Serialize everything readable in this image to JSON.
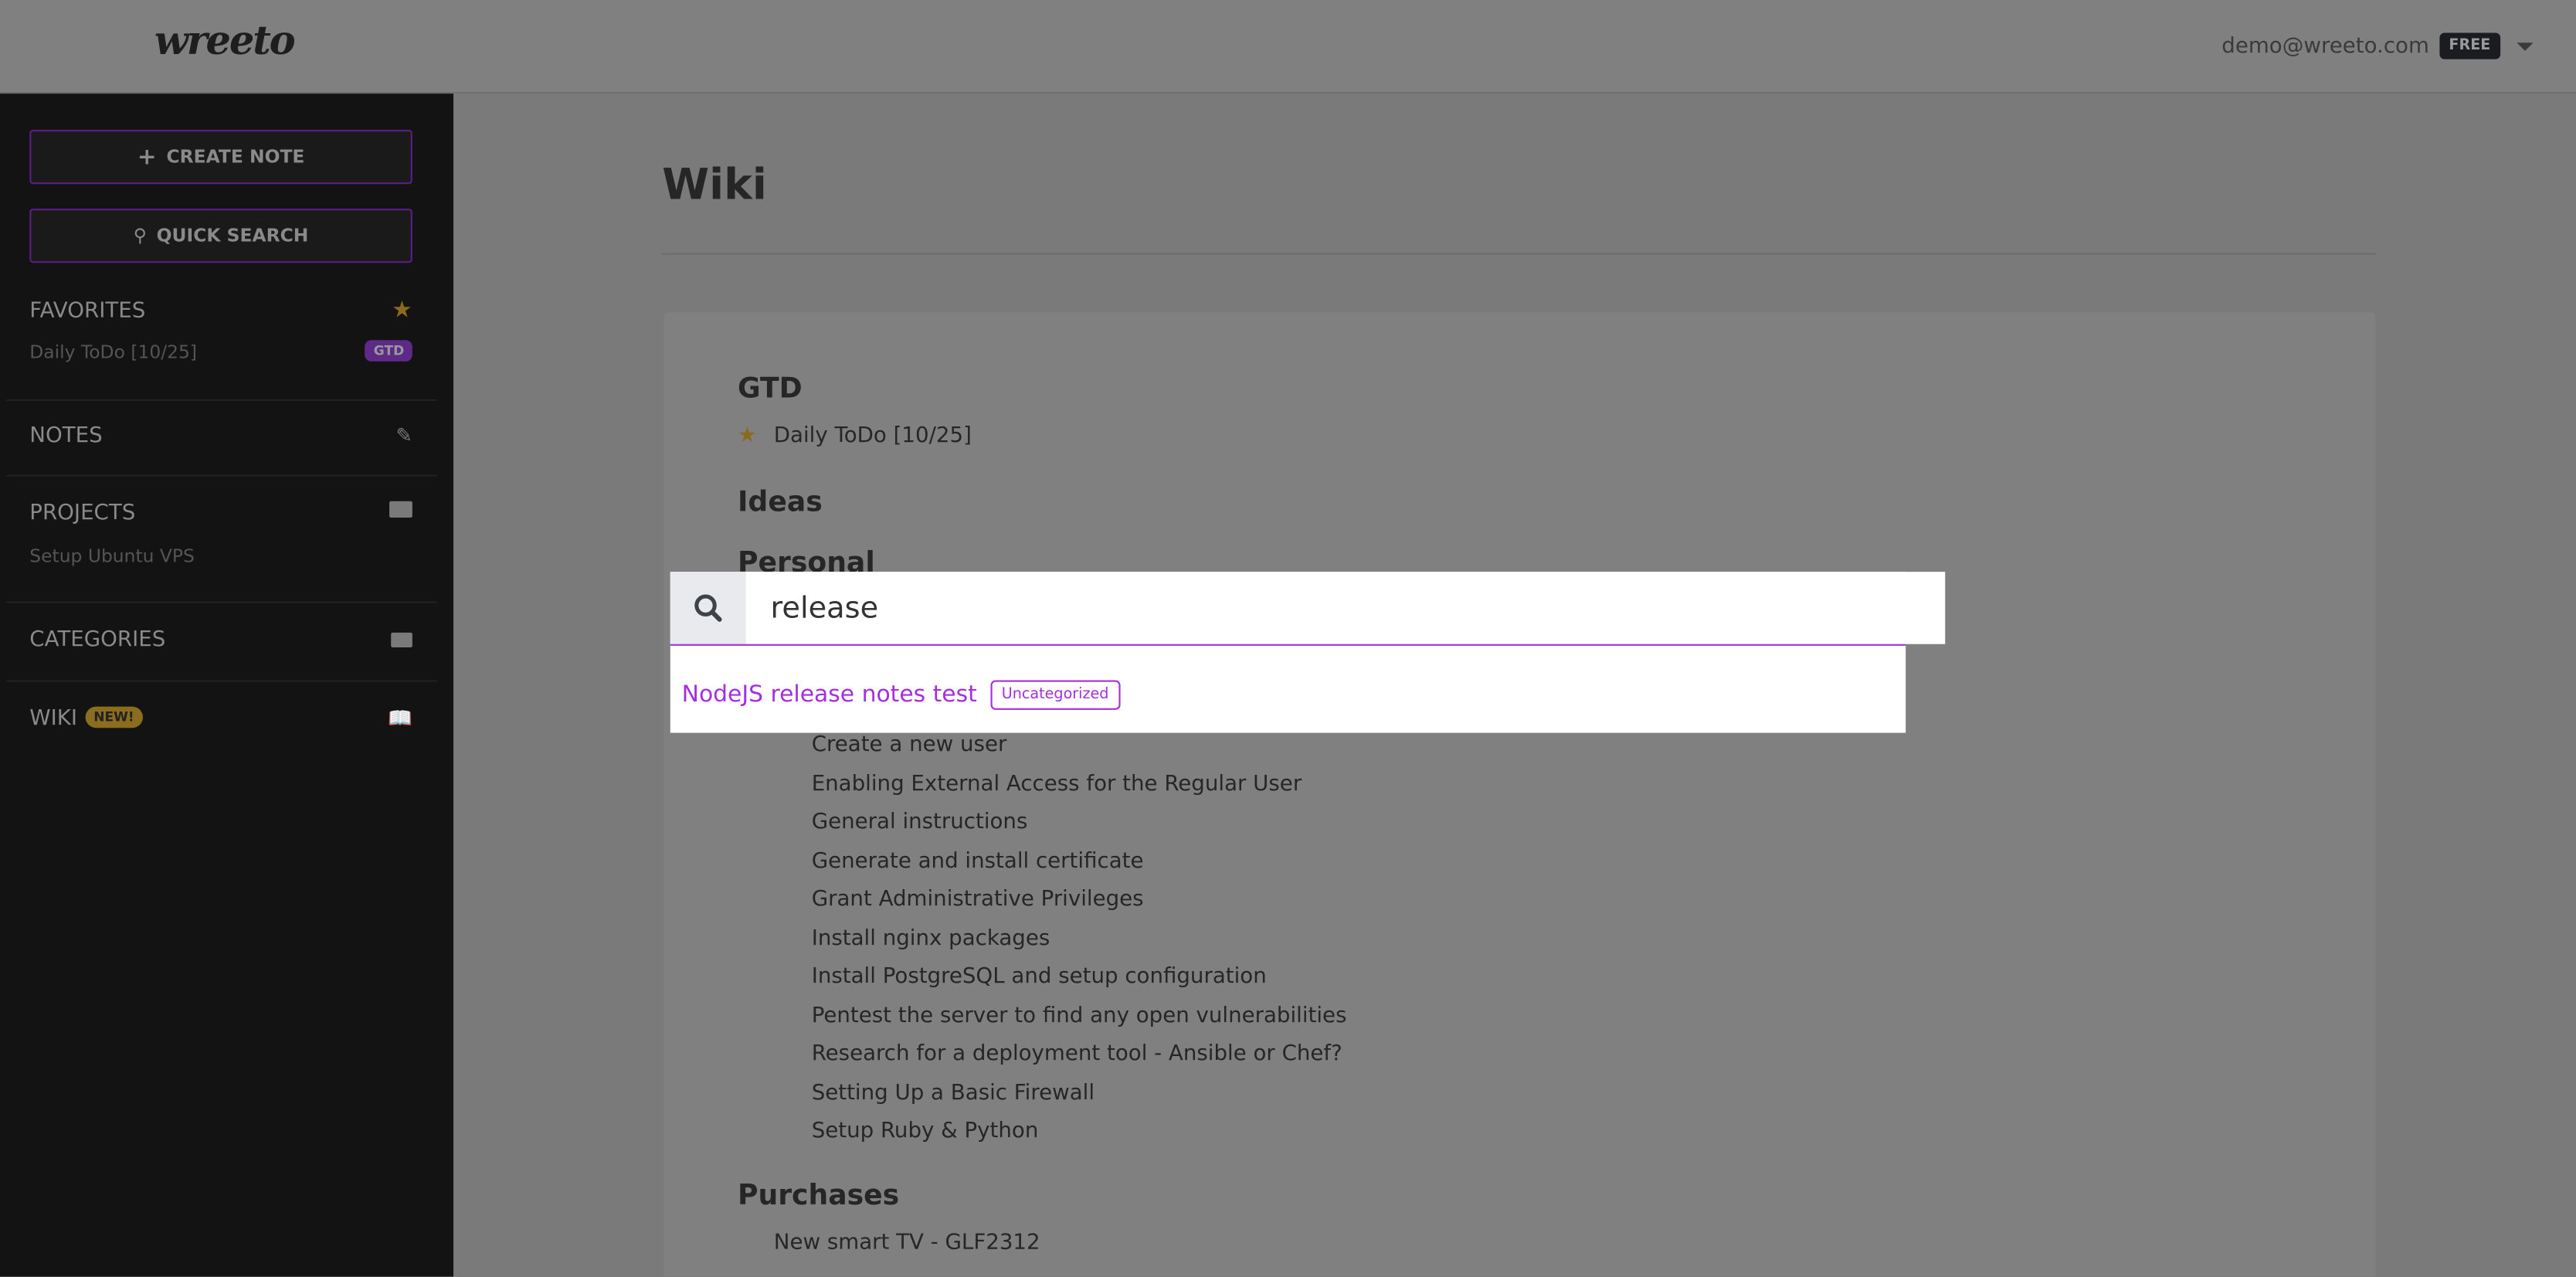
{
  "header": {
    "logo": "wreeto",
    "user_email": "demo@wreeto.com",
    "plan_badge": "FREE"
  },
  "sidebar": {
    "create_note": "CREATE NOTE",
    "quick_search": "QUICK SEARCH",
    "favorites": {
      "label": "FAVORITES",
      "items": [
        {
          "label": "Daily ToDo [10/25]",
          "badge": "GTD"
        }
      ]
    },
    "notes": {
      "label": "NOTES"
    },
    "projects": {
      "label": "PROJECTS",
      "items": [
        "Setup Ubuntu VPS"
      ]
    },
    "categories": {
      "label": "CATEGORIES"
    },
    "wiki": {
      "label": "WIKI",
      "badge": "NEW!"
    }
  },
  "main": {
    "title": "Wiki",
    "sections": {
      "gtd": {
        "title": "GTD",
        "items": [
          "Daily ToDo [10/25]"
        ]
      },
      "ideas": {
        "title": "Ideas"
      },
      "personal": {
        "title": "Personal",
        "items": [
          "Create a new user",
          "Enabling External Access for the Regular User",
          "General instructions",
          "Generate and install certificate",
          "Grant Administrative Privileges",
          "Install nginx packages",
          "Install PostgreSQL and setup configuration",
          "Pentest the server to find any open vulnerabilities",
          "Research for a deployment tool - Ansible or Chef?",
          "Setting Up a Basic Firewall",
          "Setup Ruby & Python"
        ]
      },
      "purchases": {
        "title": "Purchases",
        "items": [
          "New smart TV - GLF2312"
        ]
      }
    }
  },
  "search": {
    "query": "release",
    "results": [
      {
        "title": "NodeJS release notes test",
        "category": "Uncategorized"
      }
    ]
  },
  "colors": {
    "accent": "#a42ee0",
    "favorite_star": "#c9a227",
    "gtd_badge": "#5e2a87",
    "new_badge": "#c9a227"
  }
}
